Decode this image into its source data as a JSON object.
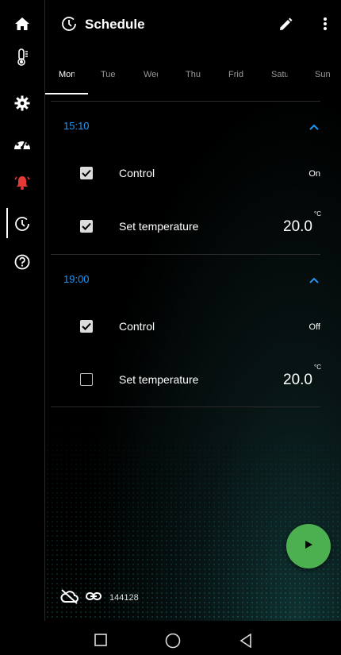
{
  "sidebar": {
    "items": [
      {
        "name": "home-icon"
      },
      {
        "name": "thermometer-icon"
      },
      {
        "name": "settings-icon"
      },
      {
        "name": "dashboard-icon"
      },
      {
        "name": "alarm-icon",
        "color": "#e53935"
      },
      {
        "name": "schedule-icon",
        "active": true
      },
      {
        "name": "help-icon"
      }
    ]
  },
  "header": {
    "title": "Schedule",
    "icon": "schedule-icon",
    "actions": [
      "edit-icon",
      "more-vert-icon"
    ]
  },
  "tabs": [
    {
      "label": "Mon",
      "active": true
    },
    {
      "label": "Tue"
    },
    {
      "label": "Wed"
    },
    {
      "label": "Thu"
    },
    {
      "label": "Frid"
    },
    {
      "label": "Satu"
    },
    {
      "label": "Sun"
    }
  ],
  "schedule": [
    {
      "time": "15:10",
      "rows": [
        {
          "label": "Control",
          "checked": true,
          "value": "On"
        },
        {
          "label": "Set temperature",
          "checked": true,
          "value": "20.0",
          "unit": "°C"
        }
      ]
    },
    {
      "time": "19:00",
      "rows": [
        {
          "label": "Control",
          "checked": true,
          "value": "Off"
        },
        {
          "label": "Set temperature",
          "checked": false,
          "value": "20.0",
          "unit": "°C"
        }
      ]
    }
  ],
  "status": {
    "cloud_icon": "cloud-off-icon",
    "link_icon": "link-icon",
    "device_id": "144128"
  },
  "fab": {
    "icon": "play-icon",
    "color": "#4caf50"
  },
  "navbar": [
    "square-icon",
    "circle-icon",
    "triangle-back-icon"
  ]
}
